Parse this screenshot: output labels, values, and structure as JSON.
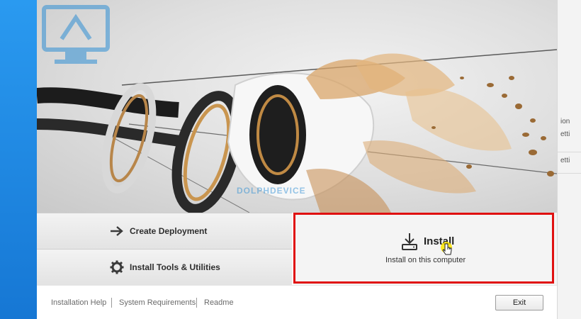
{
  "installer": {
    "options": {
      "create_deployment": "Create Deployment",
      "install_tools": "Install Tools & Utilities",
      "install_title": "Install",
      "install_subtitle": "Install on this computer"
    },
    "footer": {
      "installation_help": "Installation Help",
      "system_requirements": "System Requirements",
      "readme": "Readme",
      "exit": "Exit"
    },
    "watermark": "DOLPHDEVICE"
  },
  "background_window": {
    "fragments": [
      "ion",
      "etti",
      "etti"
    ]
  },
  "colors": {
    "highlight": "#e01010",
    "desktop": "#1e88e5"
  },
  "icons": {
    "create_deployment": "arrow-right-icon",
    "install_tools": "gear-icon",
    "install": "download-icon"
  }
}
